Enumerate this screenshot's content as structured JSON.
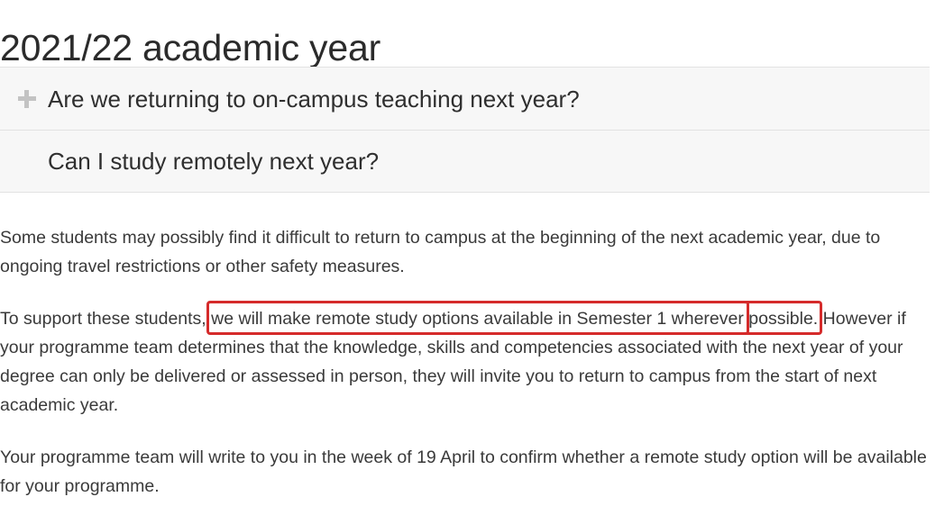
{
  "page": {
    "title": "2021/22 academic year"
  },
  "accordion": {
    "items": [
      {
        "label": "Are we returning to on-campus teaching next year?",
        "icon": "plus-icon",
        "icon_visible": true,
        "expanded": false
      },
      {
        "label": "Can I study remotely next year?",
        "icon": "minus-icon",
        "icon_visible": false,
        "expanded": true
      }
    ]
  },
  "content": {
    "paragraph_1": "Some students may possibly find it difficult to return to campus at the beginning of the next academic year, due to ongoing travel restrictions or other safety measures.",
    "paragraph_2_lead": "To support these students, ",
    "paragraph_2_highlight_1": "we will make remote study options available in Semester 1 wherever",
    "paragraph_2_highlight_2": "possible.",
    "paragraph_2_tail": " However if your programme team determines that the knowledge, skills and competencies associated with the next year of your degree can only be delivered or assessed in person, they will invite you to return to campus from the start of next academic year.",
    "paragraph_3": "Your programme team will write to you in the week of 19 April to confirm whether a remote study option will be available for your programme."
  },
  "annotations": {
    "highlight_color": "#d52b2b",
    "count": 2
  },
  "colors": {
    "background": "#ffffff",
    "panel_background": "#f7f7f7",
    "panel_border": "#e2e2e2",
    "text": "#3a3a3a",
    "heading": "#2b2b2b",
    "icon": "#c3c3c3"
  }
}
